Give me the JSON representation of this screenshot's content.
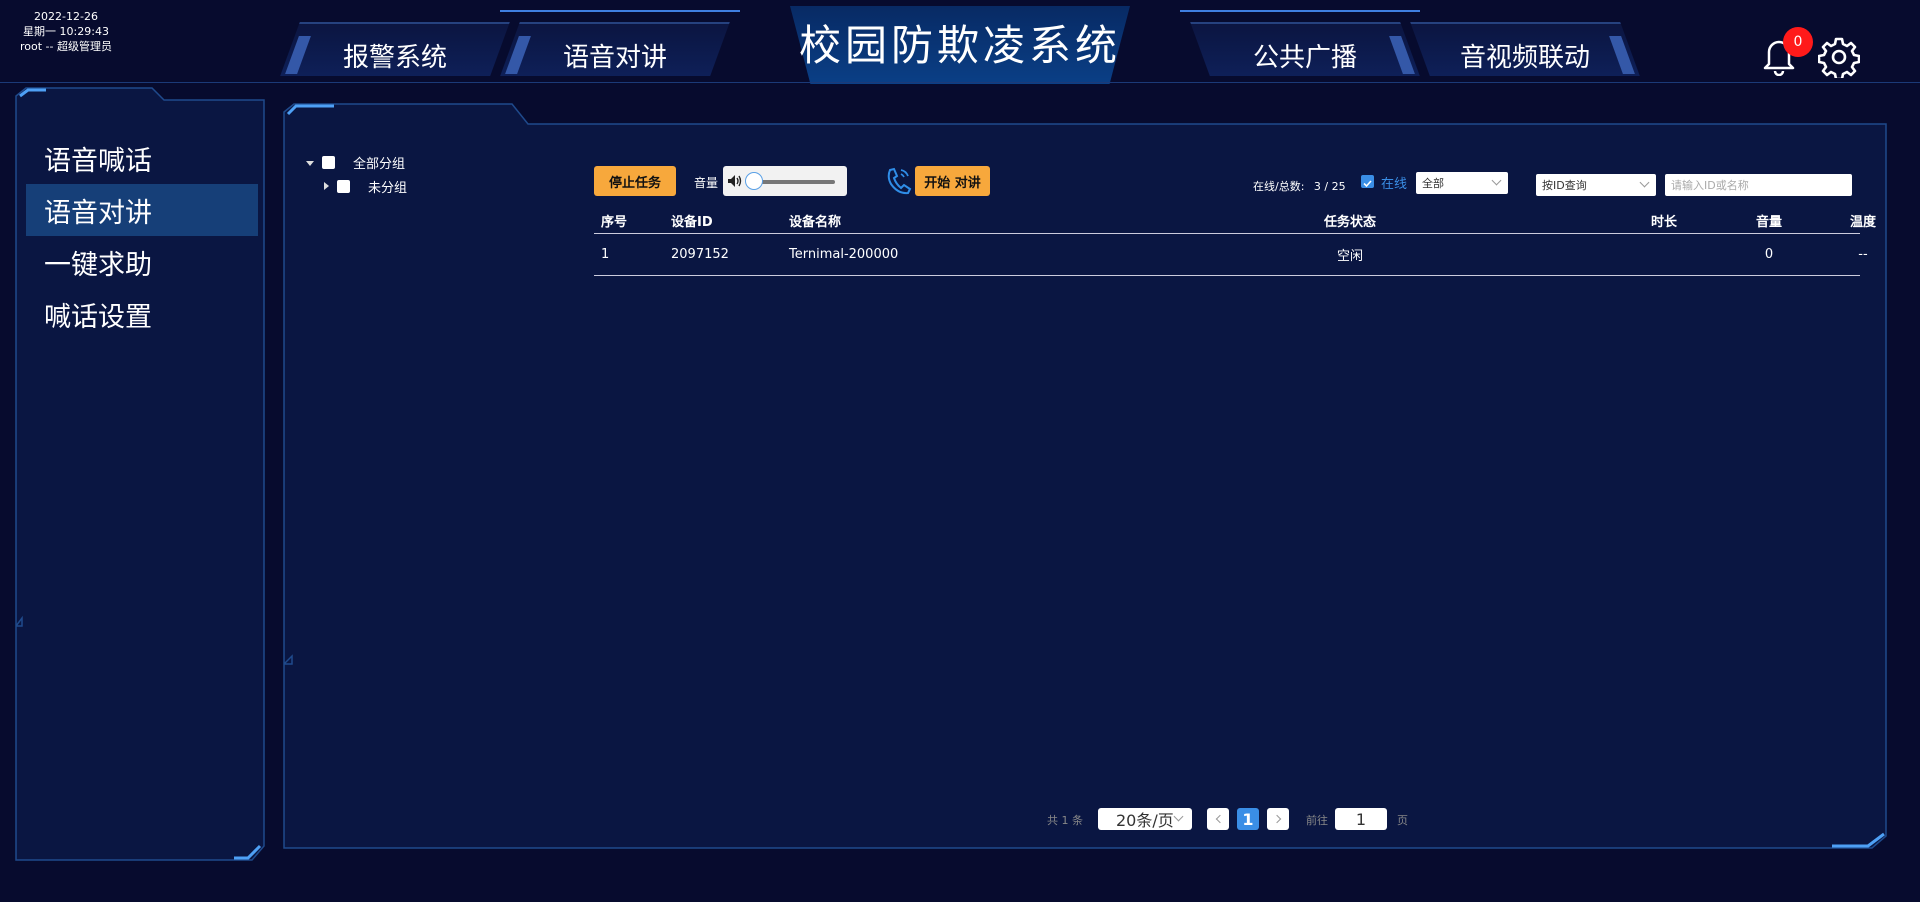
{
  "header": {
    "date": "2022-12-26",
    "weekday_time": "星期一 10:29:43",
    "user": "root -- 超级管理员",
    "title": "校园防欺凌系统",
    "nav_left": [
      "报警系统",
      "语音对讲"
    ],
    "nav_right": [
      "公共广播",
      "音视频联动"
    ],
    "notification_count": "0"
  },
  "sidebar": {
    "items": [
      {
        "label": "语音喊话",
        "active": false
      },
      {
        "label": "语音对讲",
        "active": true
      },
      {
        "label": "一键求助",
        "active": false
      },
      {
        "label": "喊话设置",
        "active": false
      }
    ]
  },
  "tree": {
    "root": "全部分组",
    "child": "未分组"
  },
  "toolbar": {
    "stop_task": "停止任务",
    "volume_label": "音量",
    "volume_level": 0,
    "start_talk": "开始 对讲",
    "online_total_label": "在线/总数:",
    "online_total_value": "3 / 25",
    "online_checkbox_label": "在线",
    "filter_all": "全部",
    "query_by": "按ID查询",
    "search_placeholder": "请输入ID或名称"
  },
  "table": {
    "columns": [
      "序号",
      "设备ID",
      "设备名称",
      "任务状态",
      "时长",
      "音量",
      "温度"
    ],
    "rows": [
      [
        "1",
        "2097152",
        "Ternimal-200000",
        "空闲",
        "",
        "0",
        "--"
      ]
    ]
  },
  "pager": {
    "total": "共 1 条",
    "page_size": "20条/页",
    "current_page": "1",
    "goto_label": "前往",
    "goto_value": "1",
    "page_suffix": "页"
  },
  "colors": {
    "background": "#070b2e",
    "accent_orange": "#f7a83c",
    "accent_blue": "#3a8ee6",
    "active_menu": "#163f78",
    "badge_red": "#ff1a1a"
  }
}
